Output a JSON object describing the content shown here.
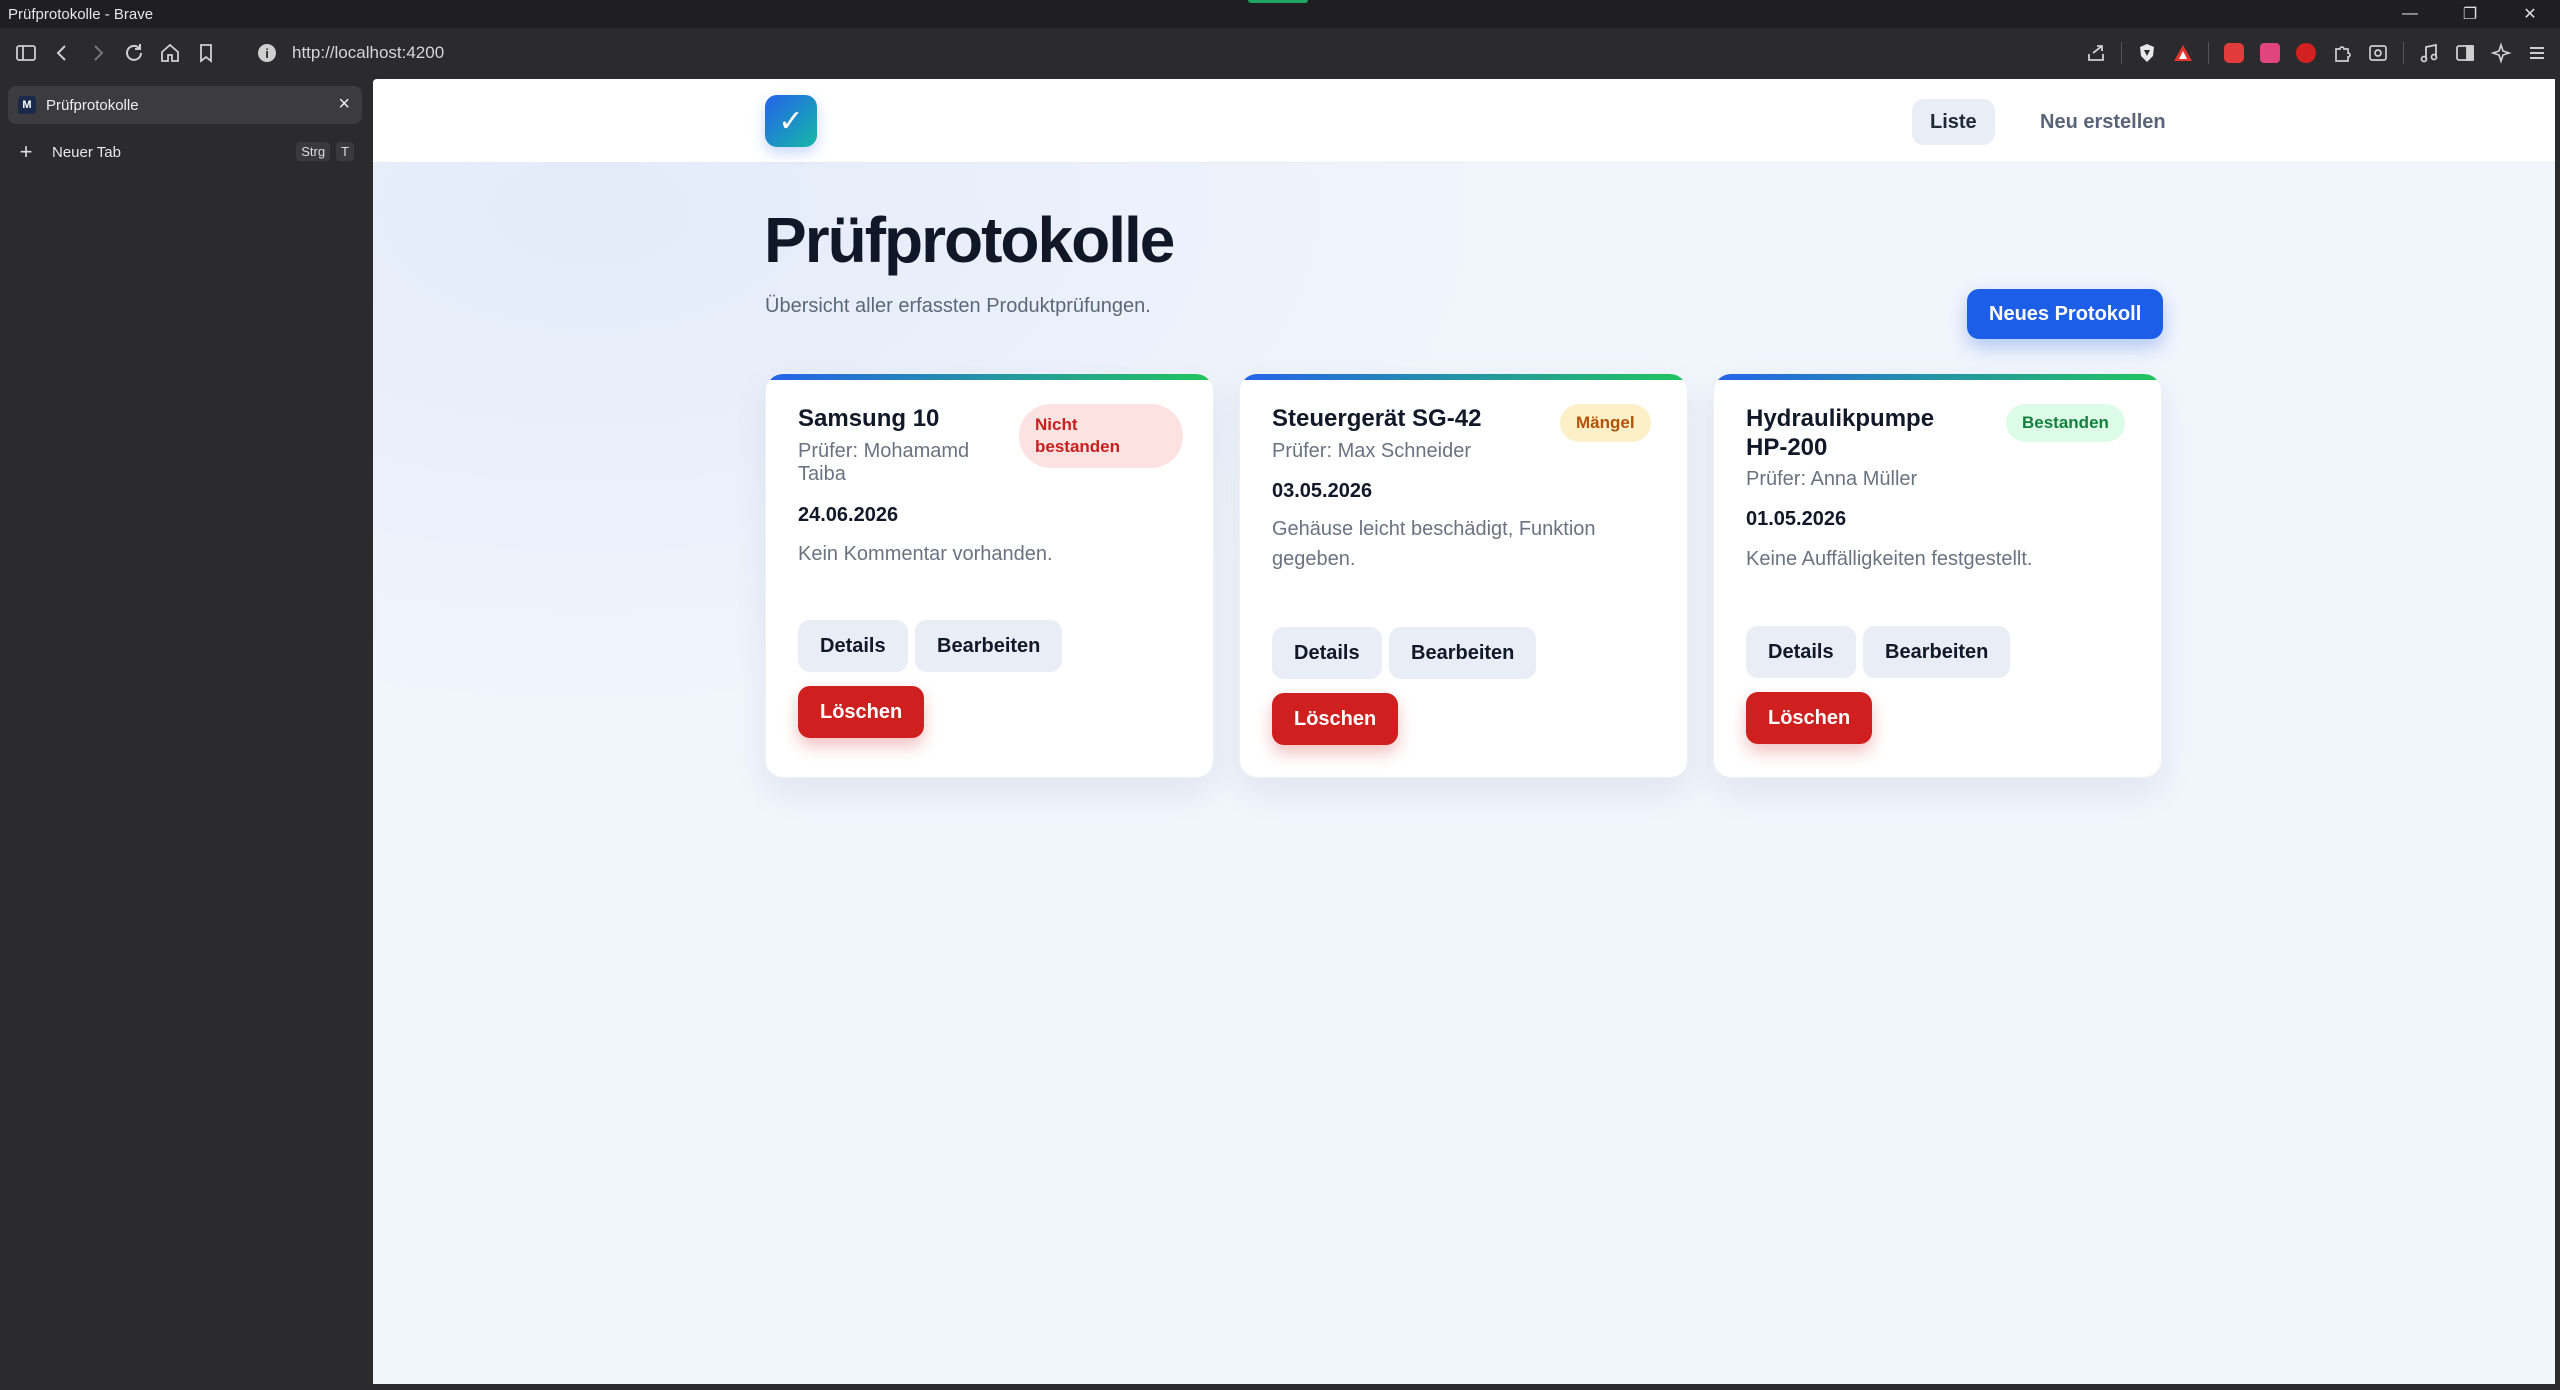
{
  "window": {
    "title": "Prüfprotokolle - Brave"
  },
  "browser": {
    "url": "http://localhost:4200",
    "tab": {
      "favicon": "M",
      "title": "Prüfprotokolle"
    },
    "new_tab": {
      "label": "Neuer Tab",
      "shortcut_mod": "Strg",
      "shortcut_key": "T"
    }
  },
  "app": {
    "logo": "✓",
    "nav": {
      "list": "Liste",
      "create": "Neu erstellen"
    },
    "title": "Prüfprotokolle",
    "subtitle": "Übersicht aller erfassten Produktprüfungen.",
    "new_button": "Neues Protokoll",
    "colors": {
      "primary": "#1d5ee8",
      "danger": "#d01f1f"
    },
    "cards": [
      {
        "name": "Samsung 10",
        "tester": "Prüfer: Mohamamd Taiba",
        "date": "24.06.2026",
        "comment": "Kein Kommentar vorhanden.",
        "status": "Nicht bestanden",
        "status_type": "fail"
      },
      {
        "name": "Steuergerät SG-42",
        "tester": "Prüfer: Max Schneider",
        "date": "03.05.2026",
        "comment": "Gehäuse leicht beschädigt, Funktion gegeben.",
        "status": "Mängel",
        "status_type": "warn"
      },
      {
        "name": "Hydraulikpumpe HP-200",
        "tester": "Prüfer: Anna Müller",
        "date": "01.05.2026",
        "comment": "Keine Auffälligkeiten festgestellt.",
        "status": "Bestanden",
        "status_type": "pass"
      }
    ],
    "card_buttons": {
      "details": "Details",
      "edit": "Bearbeiten",
      "delete": "Löschen"
    }
  }
}
